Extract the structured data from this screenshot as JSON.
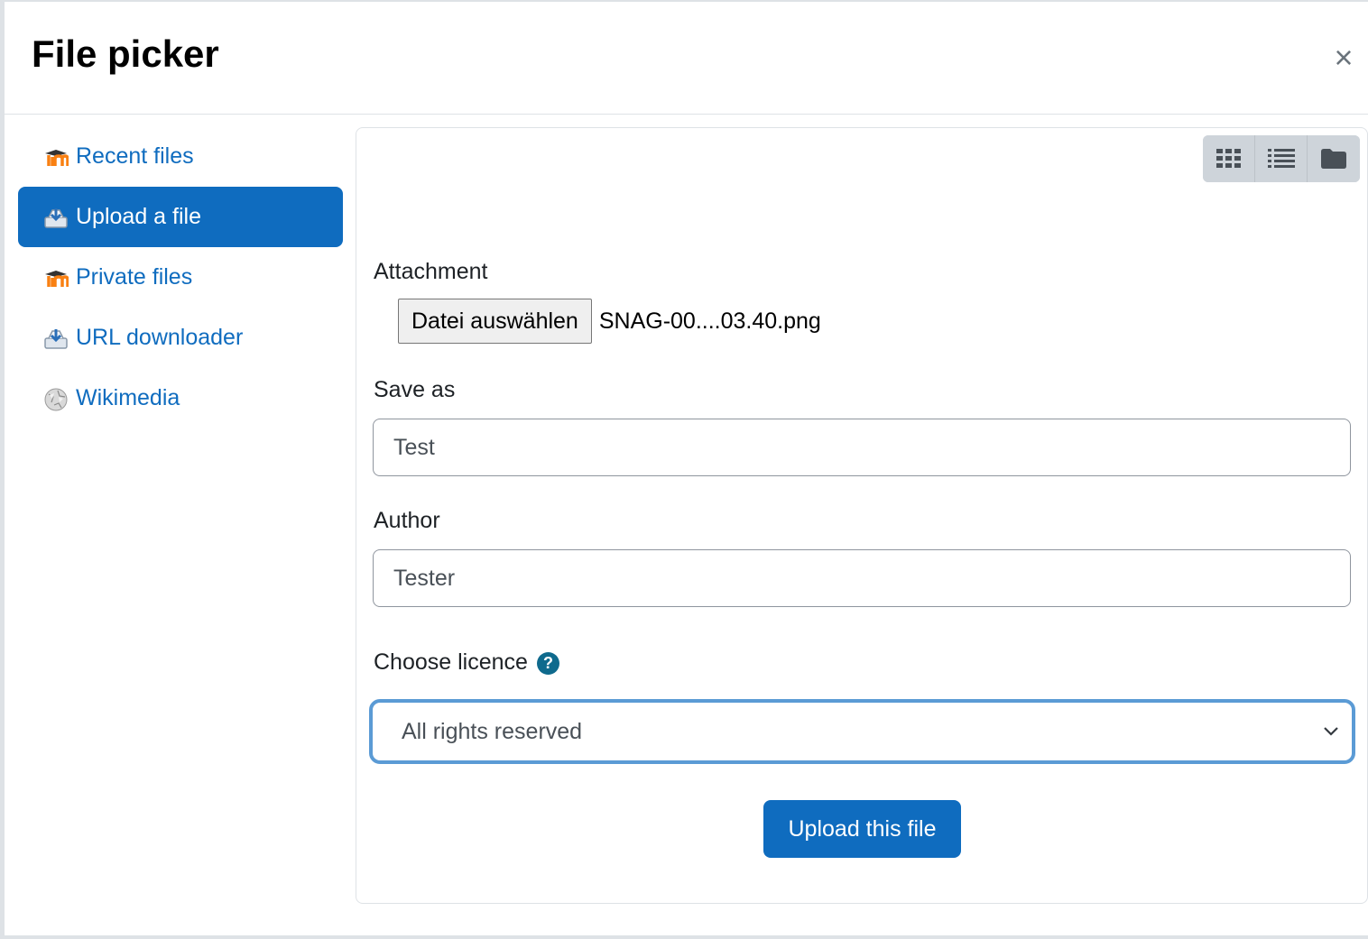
{
  "dialog": {
    "title": "File picker",
    "close_label": "×"
  },
  "sidebar": {
    "items": [
      {
        "label": "Recent files",
        "icon": "moodle-icon",
        "active": false
      },
      {
        "label": "Upload a file",
        "icon": "upload-icon",
        "active": true
      },
      {
        "label": "Private files",
        "icon": "moodle-icon",
        "active": false
      },
      {
        "label": "URL downloader",
        "icon": "url-download-icon",
        "active": false
      },
      {
        "label": "Wikimedia",
        "icon": "wikimedia-icon",
        "active": false
      }
    ]
  },
  "toolbar": {
    "views": [
      "grid-view-icon",
      "list-view-icon",
      "folder-view-icon"
    ]
  },
  "form": {
    "attachment_label": "Attachment",
    "choose_file_button": "Datei auswählen",
    "chosen_file_name": "SNAG-00....03.40.png",
    "save_as_label": "Save as",
    "save_as_value": "Test",
    "author_label": "Author",
    "author_value": "Tester",
    "licence_label": "Choose licence",
    "licence_help": "?",
    "licence_selected": "All rights reserved",
    "upload_button": "Upload this file"
  },
  "colors": {
    "primary": "#0f6cbf",
    "focus_ring": "#5b9bd5",
    "help": "#0f6a8d"
  }
}
